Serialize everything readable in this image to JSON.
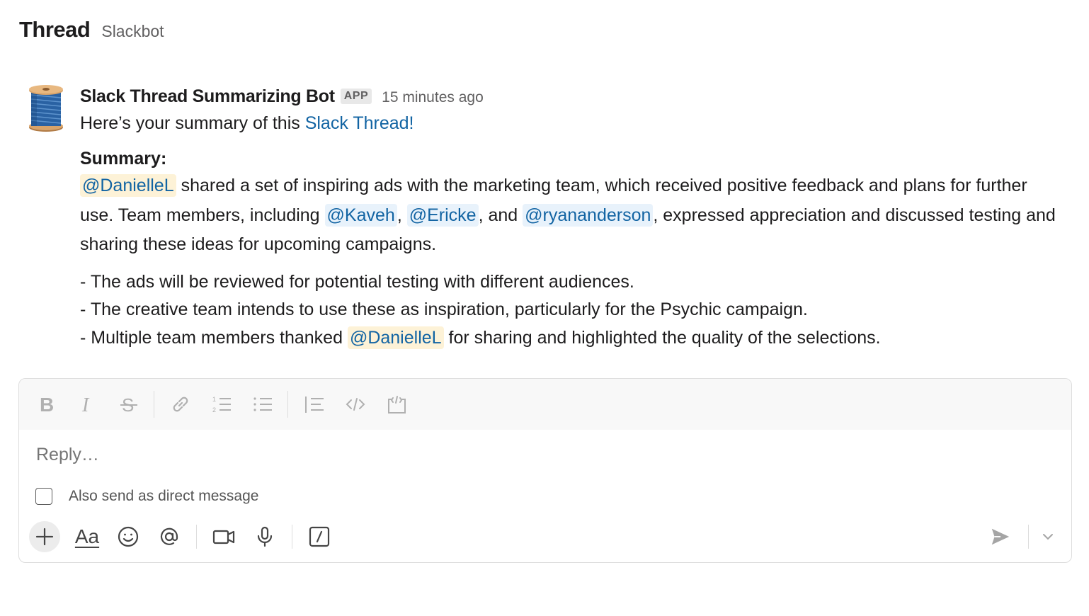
{
  "header": {
    "title": "Thread",
    "subtitle": "Slackbot"
  },
  "message": {
    "sender": "Slack Thread Summarizing Bot",
    "badge": "APP",
    "time": "15 minutes ago",
    "intro_prefix": "Here’s your summary of this ",
    "intro_link": "Slack Thread!",
    "summary_label": "Summary:",
    "summary": {
      "mention1": "@DanielleL",
      "text1": " shared a set of inspiring ads with the marketing team, which received positive feedback and plans for further use. Team members, including ",
      "mention2": "@Kaveh",
      "sep1": ", ",
      "mention3": "@Ericke",
      "sep2": ", and ",
      "mention4": "@ryananderson",
      "text2": ", expressed appreciation and discussed testing and sharing these ideas for upcoming campaigns."
    },
    "bullets": {
      "b1": "- The ads will be reviewed for potential testing with different audiences.",
      "b2": "- The creative team intends to use these as inspiration, particularly for the Psychic campaign.",
      "b3_prefix": "- Multiple team members thanked ",
      "b3_mention": "@DanielleL",
      "b3_suffix": " for sharing and highlighted the quality of the selections."
    }
  },
  "composer": {
    "placeholder": "Reply…",
    "dm_label": "Also send as direct message",
    "dm_checked": false,
    "toolbar_icons": [
      "bold-icon",
      "italic-icon",
      "strikethrough-icon",
      "link-icon",
      "ordered-list-icon",
      "bulleted-list-icon",
      "blockquote-icon",
      "code-icon",
      "code-block-icon"
    ],
    "bottom_icons": [
      "plus-icon",
      "formatting-aa-icon",
      "emoji-icon",
      "mention-at-icon",
      "video-icon",
      "microphone-icon",
      "slash-command-icon",
      "send-icon",
      "chevron-down-icon"
    ],
    "format_label": "Aa"
  },
  "colors": {
    "link": "#1264a3",
    "mention_bg": "#e8f2fb",
    "self_mention_bg": "#fdf2d7"
  }
}
